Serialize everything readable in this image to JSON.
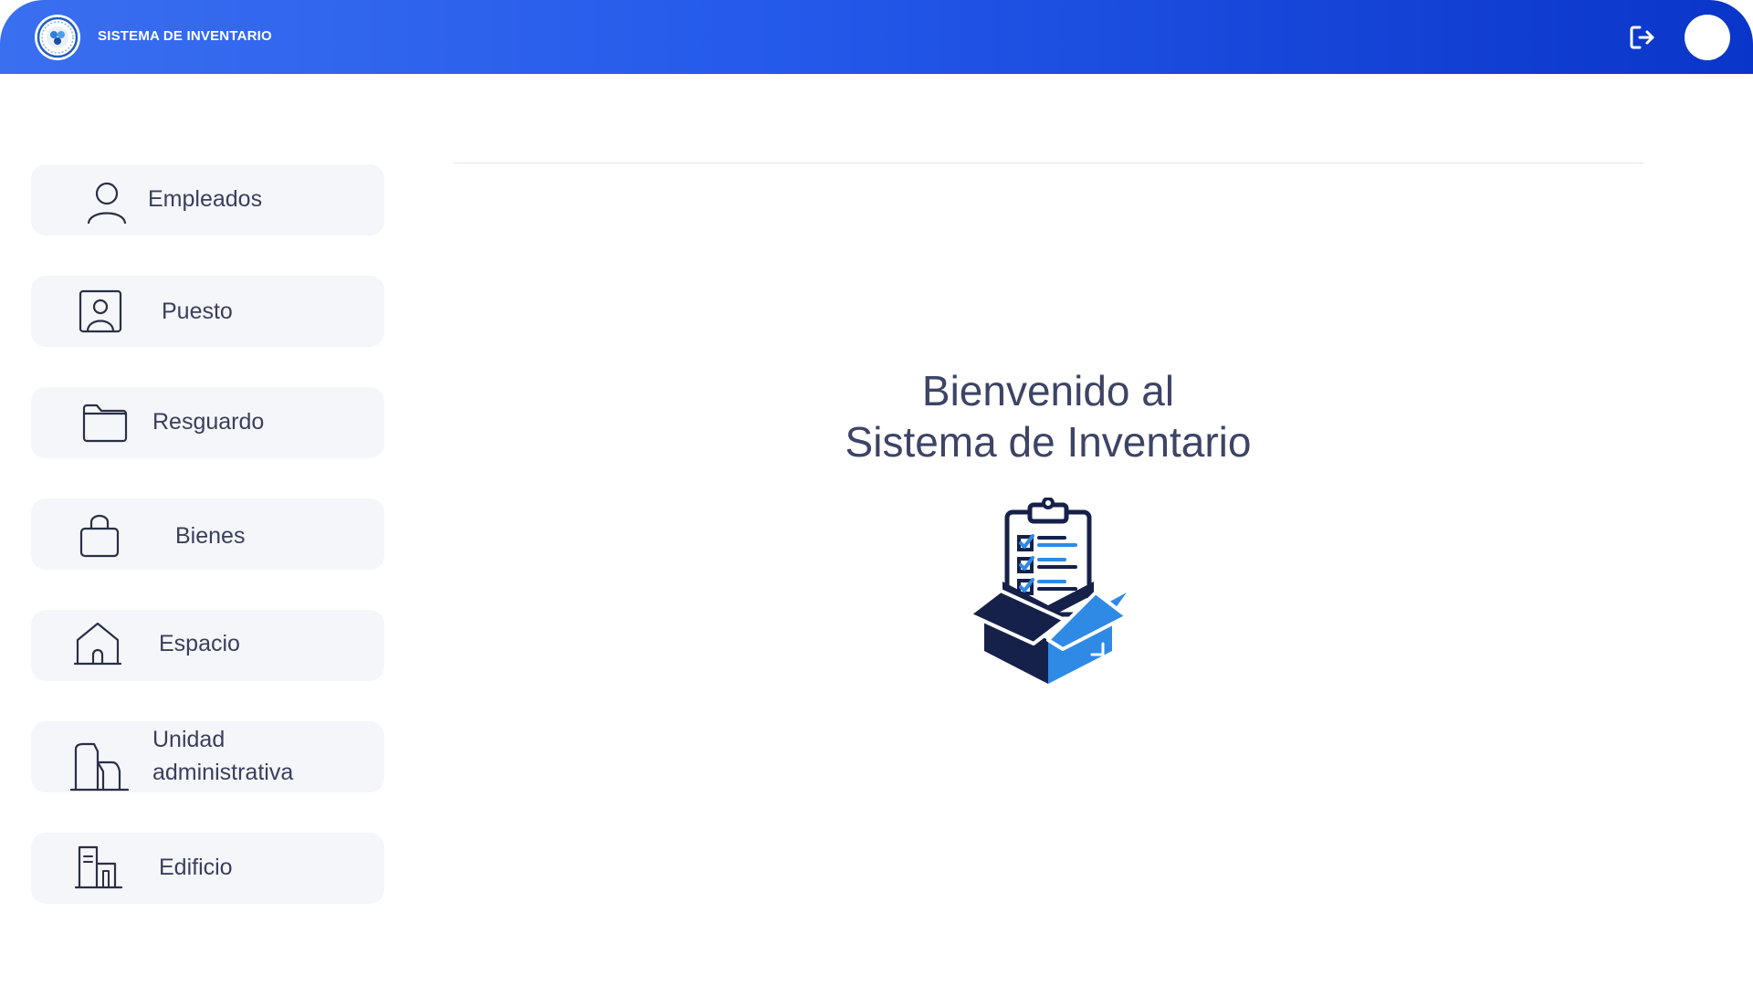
{
  "header": {
    "app_title": "SISTEMA DE INVENTARIO",
    "logo_icon": "institution-logo-icon",
    "logout_icon": "logout-icon"
  },
  "sidebar": {
    "items": [
      {
        "label": "Empleados",
        "icon": "user-icon"
      },
      {
        "label": "Puesto",
        "icon": "id-badge-icon"
      },
      {
        "label": "Resguardo",
        "icon": "folder-icon"
      },
      {
        "label": "Bienes",
        "icon": "bag-icon"
      },
      {
        "label": "Espacio",
        "icon": "house-icon"
      },
      {
        "label": "Unidad administrativa",
        "icon": "buildings-icon"
      },
      {
        "label": "Edificio",
        "icon": "building-icon"
      }
    ]
  },
  "main": {
    "welcome_line1": "Bienvenido al",
    "welcome_line2": "Sistema de Inventario",
    "illustration": "inventory-box-clipboard-icon"
  },
  "colors": {
    "header_gradient_start": "#3a6ff0",
    "header_gradient_end": "#0a35c9",
    "menu_background": "#f5f6fa",
    "text": "#3a3f5c",
    "illustration_dark": "#16214a",
    "illustration_blue": "#2f8ae6"
  }
}
